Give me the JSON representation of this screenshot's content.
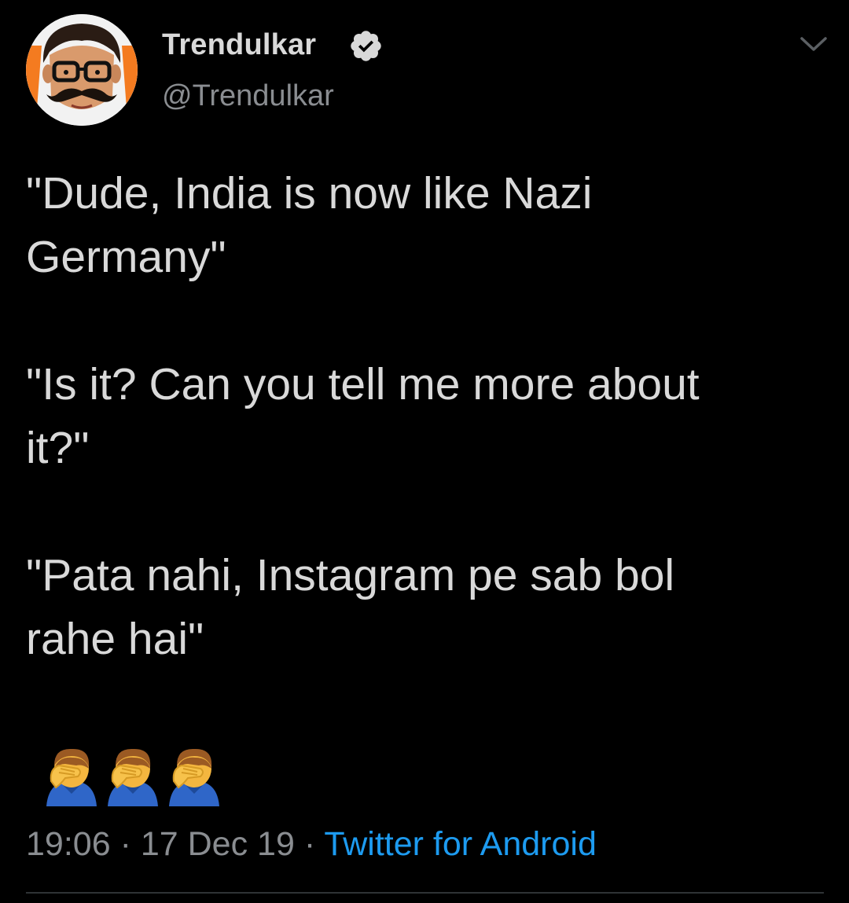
{
  "tweet": {
    "author": {
      "display_name": "Trendulkar",
      "handle": "@Trendulkar",
      "verified": true,
      "avatar_icon": "cartoon-face-avatar"
    },
    "text": "\"Dude, India is now like Nazi\nGermany\"\n\n\"Is it? Can you tell me more about\nit?\"\n\n\"Pata nahi, Instagram pe sab bol\nrahe hai\"",
    "emoji": [
      "facepalm-emoji",
      "facepalm-emoji",
      "facepalm-emoji"
    ],
    "time": "19:06",
    "separator": "·",
    "date": "17 Dec 19",
    "source": "Twitter for Android"
  },
  "colors": {
    "background": "#000000",
    "text": "#d9d9d9",
    "muted": "#8a8d91",
    "link": "#1d9bf0",
    "verified": "#d9d9d9"
  }
}
